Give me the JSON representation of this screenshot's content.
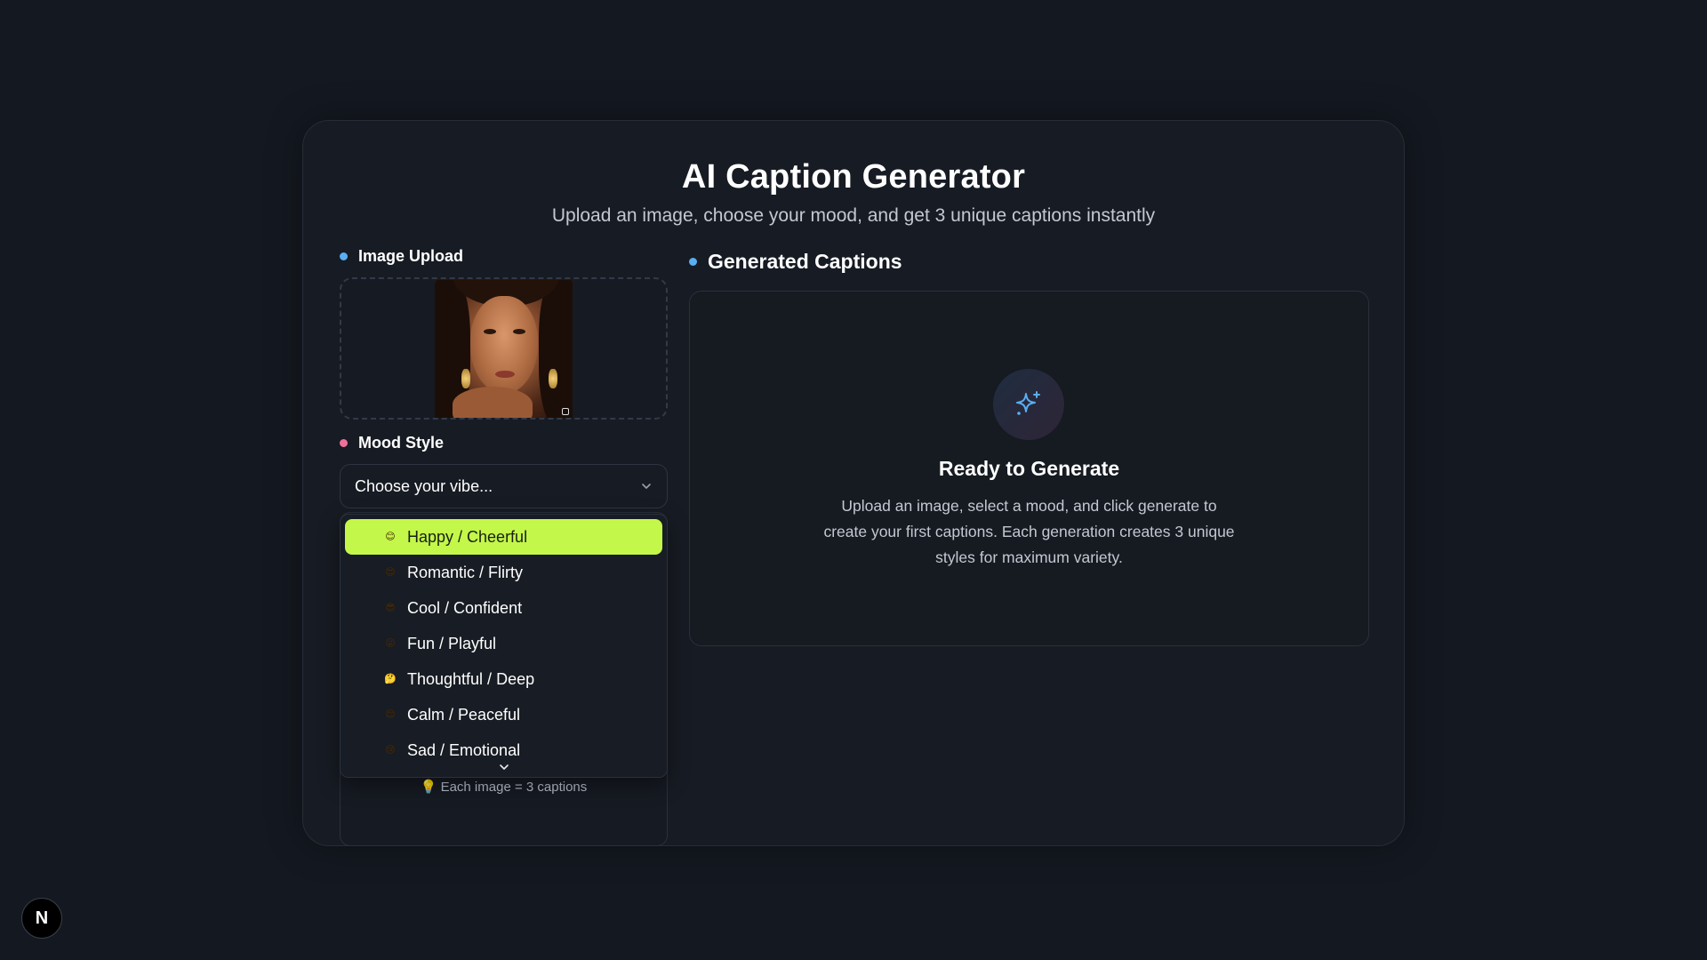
{
  "header": {
    "title": "AI Caption Generator",
    "subtitle": "Upload an image, choose your mood, and get 3 unique captions instantly"
  },
  "upload": {
    "label": "Image Upload",
    "image_alt": "uploaded portrait"
  },
  "mood": {
    "label": "Mood Style",
    "placeholder": "Choose your vibe...",
    "options": [
      {
        "emoji": "😊",
        "label": "Happy / Cheerful",
        "selected": true
      },
      {
        "emoji": "😍",
        "label": "Romantic / Flirty",
        "selected": false
      },
      {
        "emoji": "😎",
        "label": "Cool / Confident",
        "selected": false
      },
      {
        "emoji": "😜",
        "label": "Fun / Playful",
        "selected": false
      },
      {
        "emoji": "🤔",
        "label": "Thoughtful / Deep",
        "selected": false
      },
      {
        "emoji": "😌",
        "label": "Calm / Peaceful",
        "selected": false
      },
      {
        "emoji": "😢",
        "label": "Sad / Emotional",
        "selected": false
      }
    ]
  },
  "hint": {
    "icon": "lightbulb-icon",
    "text": "💡 Each image = 3 captions"
  },
  "captions": {
    "label": "Generated Captions",
    "ready_title": "Ready to Generate",
    "ready_desc": "Upload an image, select a mood, and click generate to create your first captions. Each generation creates 3 unique styles for maximum variety."
  },
  "badge": {
    "letter": "N"
  },
  "colors": {
    "accent": "#c3f74a",
    "dot_blue": "#5aaef2",
    "dot_pink": "#f0709a",
    "background": "#141820"
  }
}
